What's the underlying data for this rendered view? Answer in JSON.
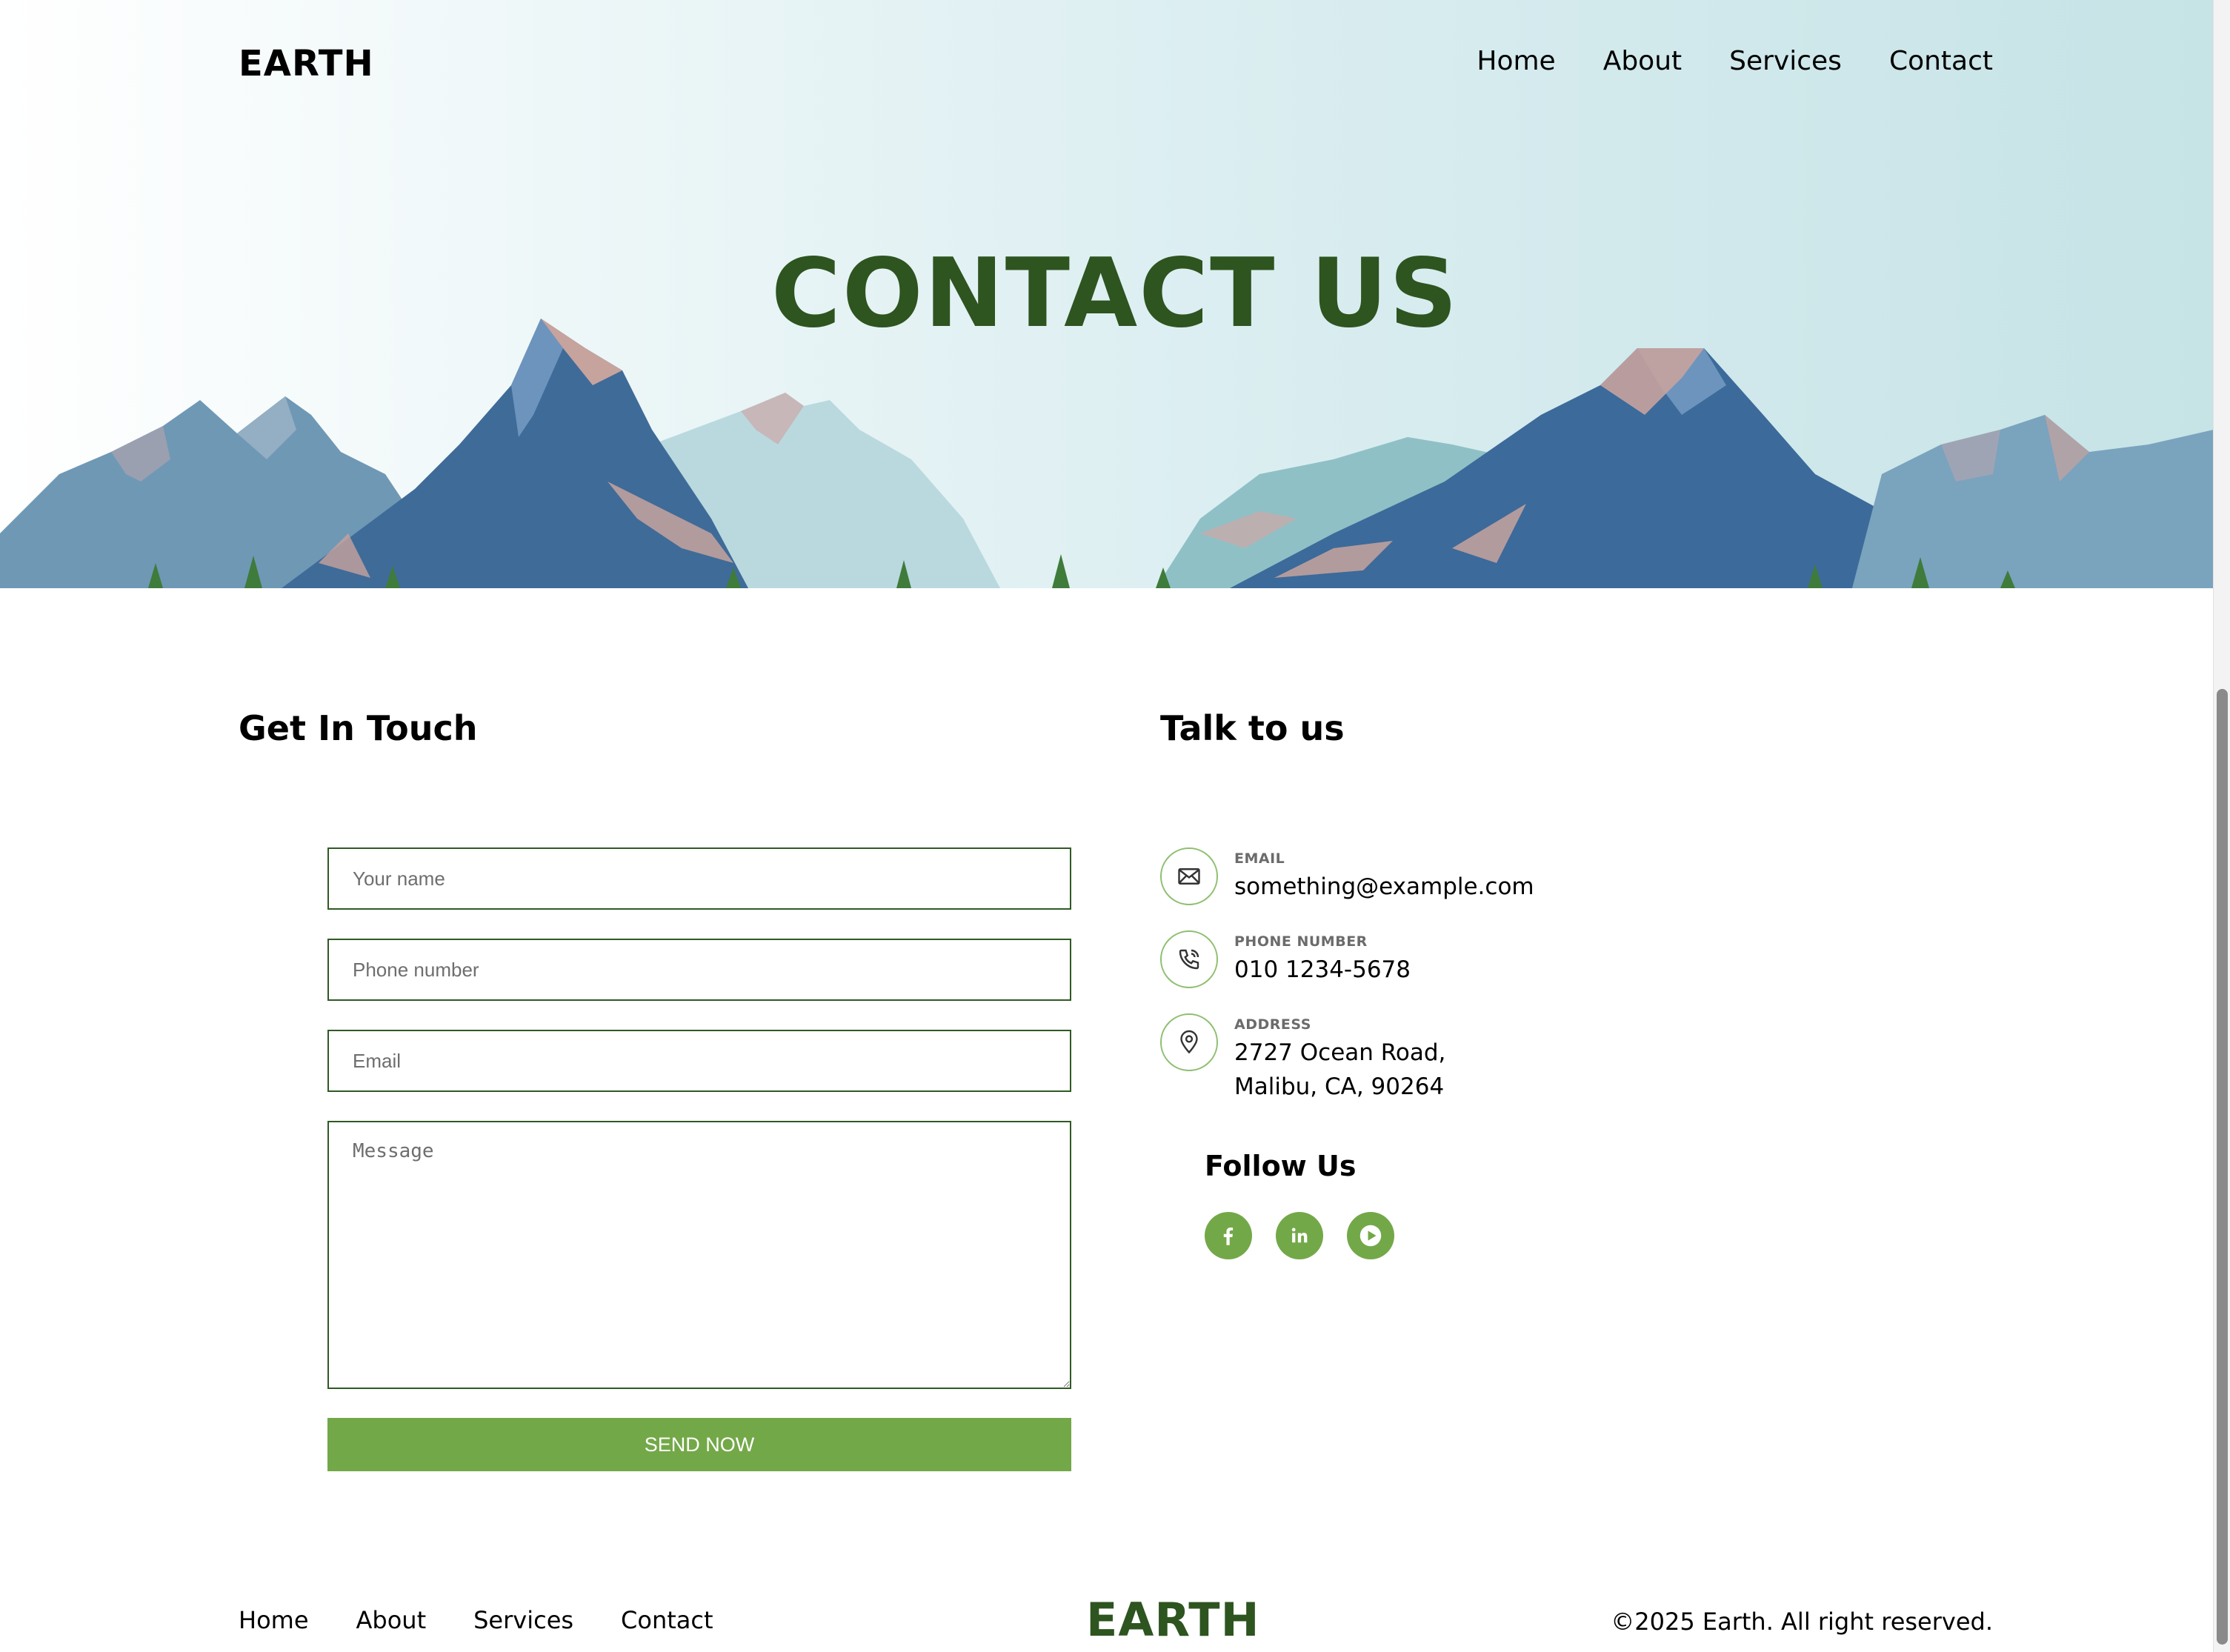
{
  "header": {
    "logo": "EARTH",
    "nav": [
      "Home",
      "About",
      "Services",
      "Contact"
    ]
  },
  "hero": {
    "title": "CONTACT US"
  },
  "form_section": {
    "heading": "Get In Touch",
    "name_placeholder": "Your name",
    "phone_placeholder": "Phone number",
    "email_placeholder": "Email",
    "message_placeholder": "Message",
    "submit_label": "SEND NOW"
  },
  "contact_section": {
    "heading": "Talk to us",
    "items": [
      {
        "icon": "envelope-icon",
        "label": "EMAIL",
        "value": "something@example.com"
      },
      {
        "icon": "phone-icon",
        "label": "PHONE NUMBER",
        "value": "010 1234-5678"
      },
      {
        "icon": "map-pin-icon",
        "label": "ADDRESS",
        "lines": [
          "2727 Ocean Road,",
          "Malibu, CA, 90264"
        ]
      }
    ],
    "follow_heading": "Follow Us",
    "social": [
      "facebook-icon",
      "linkedin-icon",
      "youtube-play-icon"
    ]
  },
  "footer": {
    "nav": [
      "Home",
      "About",
      "Services",
      "Contact"
    ],
    "logo": "EARTH",
    "copyright": "©2025 Earth. All right reserved."
  },
  "colors": {
    "brand_dark_green": "#2e5420",
    "accent_green": "#73a848",
    "input_border": "#2f5a24",
    "mountain_dark": "#3b6695",
    "mountain_light": "#a8cfd6",
    "snow_accent": "#c9a39e"
  }
}
